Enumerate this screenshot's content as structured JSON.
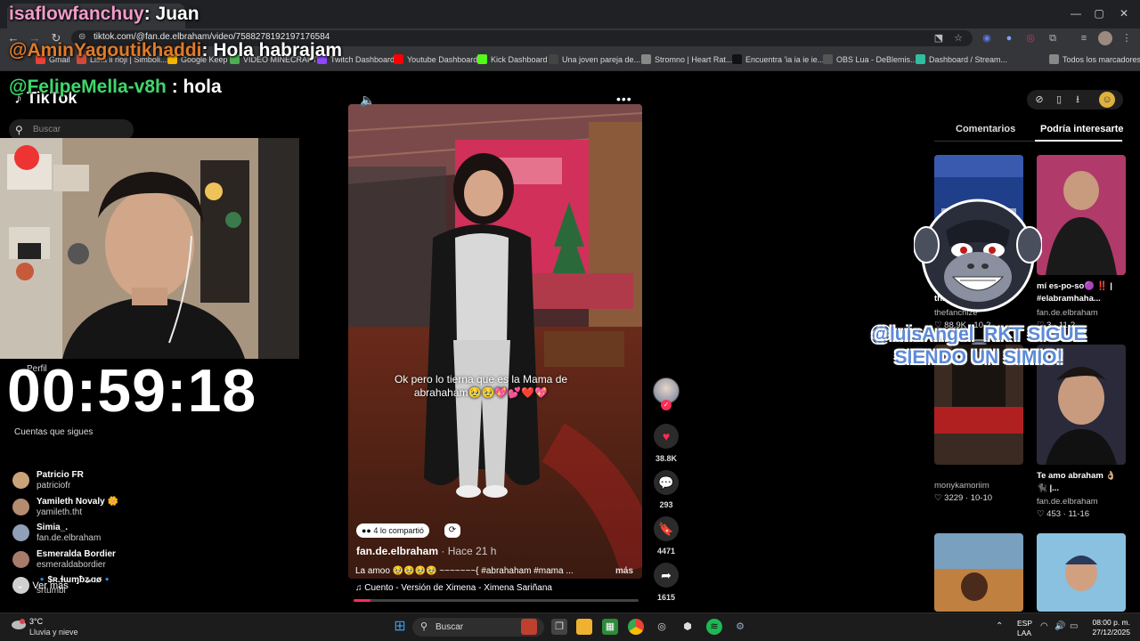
{
  "browser": {
    "url": "tiktok.com/@fan.de.elbraham/video/7588278192197176584",
    "bookmarks": [
      {
        "label": "Gmail",
        "color": "#ea4335"
      },
      {
        "label": "Lista ii rioji | Simboli...",
        "color": "#d04a3a"
      },
      {
        "label": "Google Keep",
        "color": "#f4b400"
      },
      {
        "label": "VIDEO MINECRAFT",
        "color": "#4caf50"
      },
      {
        "label": "Twitch Dashboard",
        "color": "#9146ff"
      },
      {
        "label": "Youtube Dashboard",
        "color": "#ff0000"
      },
      {
        "label": "Kick Dashboard",
        "color": "#53fc18"
      },
      {
        "label": "Una joven pareja de...",
        "color": "#444444"
      },
      {
        "label": "Stromno | Heart Rat...",
        "color": "#888888"
      },
      {
        "label": "Encuentra 'ia ia ie ie...",
        "color": "#111111"
      },
      {
        "label": "OBS Lua - DeBlemis...",
        "color": "#555555"
      },
      {
        "label": "Dashboard / Stream...",
        "color": "#2fbfa0"
      },
      {
        "label": "Todos los marcadores",
        "color": "#888888"
      }
    ]
  },
  "overlay": {
    "chat": [
      {
        "user": "isaflowfanchuy",
        "msg": ": Juan",
        "color": "#f29ccb"
      },
      {
        "user": "@AminYagoutikhaddi",
        "msg": ": Hola habrajam",
        "color": "#e07b2a"
      },
      {
        "user": "@FelipeMella-v8h",
        "msg": " : hola",
        "color": "#3fd76b"
      }
    ],
    "timer": "00:59:18",
    "follow_alert": "@luisAngel_RKT SIGUE SIENDO UN SIMIO!"
  },
  "tiktok": {
    "logo": "TikTok",
    "search_placeholder": "Buscar",
    "perfil_label": "Perfil",
    "following_title": "Cuentas que sigues",
    "following": [
      {
        "name": "Patricio FR",
        "handle": "patriciofr",
        "color": "#c9a37a"
      },
      {
        "name": "Yamileth Novaly 🌼",
        "handle": "yamileth.tht",
        "color": "#b58c70"
      },
      {
        "name": "Simia_.",
        "handle": "fan.de.elbraham",
        "color": "#8fa0b8"
      },
      {
        "name": "Esmeralda Bordier",
        "handle": "esmeraldabordier",
        "color": "#a87c6a"
      },
      {
        "name": "🔹$ʀ.ɬɯɱƀʑɑø🔹",
        "handle": "srtumbi",
        "color": "#d0d0d0"
      }
    ],
    "see_more": "Ver más",
    "video": {
      "caption": "Ok pero lo tierna que es la Mama de abrahaham🥹🥹💖💕❤️💖",
      "shared_label": "4 lo compartió",
      "author": "fan.de.elbraham",
      "time": " · Hace 21 h",
      "description": "La amoo 🥹🥹🥹🥹 ~~~~~~~{ #abrahaham #mama ...",
      "more": "más",
      "music": "♫  Cuento - Versión de Ximena - Ximena Sariñana",
      "progress_fraction": 0.06
    },
    "actions": {
      "likes": "38.8K",
      "comments": "293",
      "saves": "4471",
      "shares": "1615"
    },
    "right_panel": {
      "tab_comments": "Comentarios",
      "tab_related": "Podría interesarte",
      "cards": [
        {
          "title": "th...",
          "user": "thefanchize",
          "stats": "♡ 88.9K · 10-2"
        },
        {
          "title": "mí es-po-so🟣 ‼️ | #elabramhaha...",
          "user": "fan.de.elbraham",
          "stats": "♡ 3 · 11-2"
        },
        {
          "title": "",
          "user": "monykamoriim",
          "stats": "♡ 3229 · 10-10"
        },
        {
          "title": "Te amo abraham 👌🏼🐈‍⬛ |...",
          "user": "fan.de.elbraham",
          "stats": "♡ 453 · 11-16"
        }
      ]
    }
  },
  "taskbar": {
    "weather_temp": "3°C",
    "weather_desc": "Lluvia y nieve",
    "search": "Buscar",
    "lang1": "ESP",
    "lang2": "LAA",
    "time": "08:00 p. m.",
    "date": "27/12/2025"
  }
}
